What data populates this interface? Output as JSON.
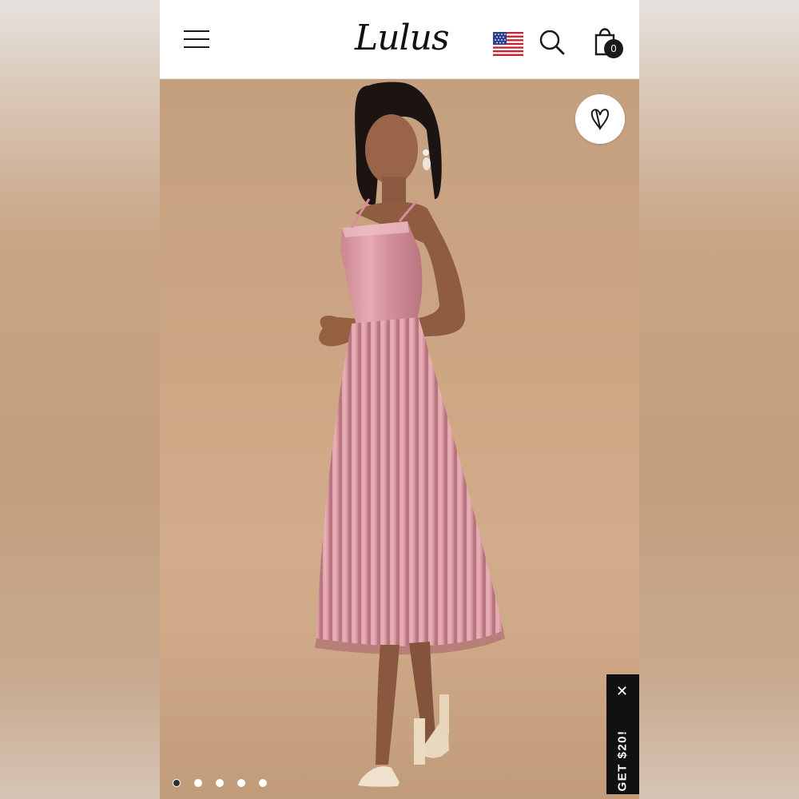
{
  "header": {
    "logo_text": "Lulus",
    "cart_count": "0",
    "icons": {
      "menu": "hamburger-menu-icon",
      "flag": "us-flag-icon",
      "search": "search-icon",
      "bag": "shopping-bag-icon",
      "wishlist": "heart-icon",
      "close": "close-icon"
    }
  },
  "promo": {
    "label": "GET $20!",
    "close": "✕"
  },
  "carousel": {
    "total": 5,
    "active_index": 1
  },
  "colors": {
    "backdrop": "#cda684",
    "dress": "#d99aa3",
    "header_bg": "#ffffff",
    "promo_bg": "#111111"
  }
}
